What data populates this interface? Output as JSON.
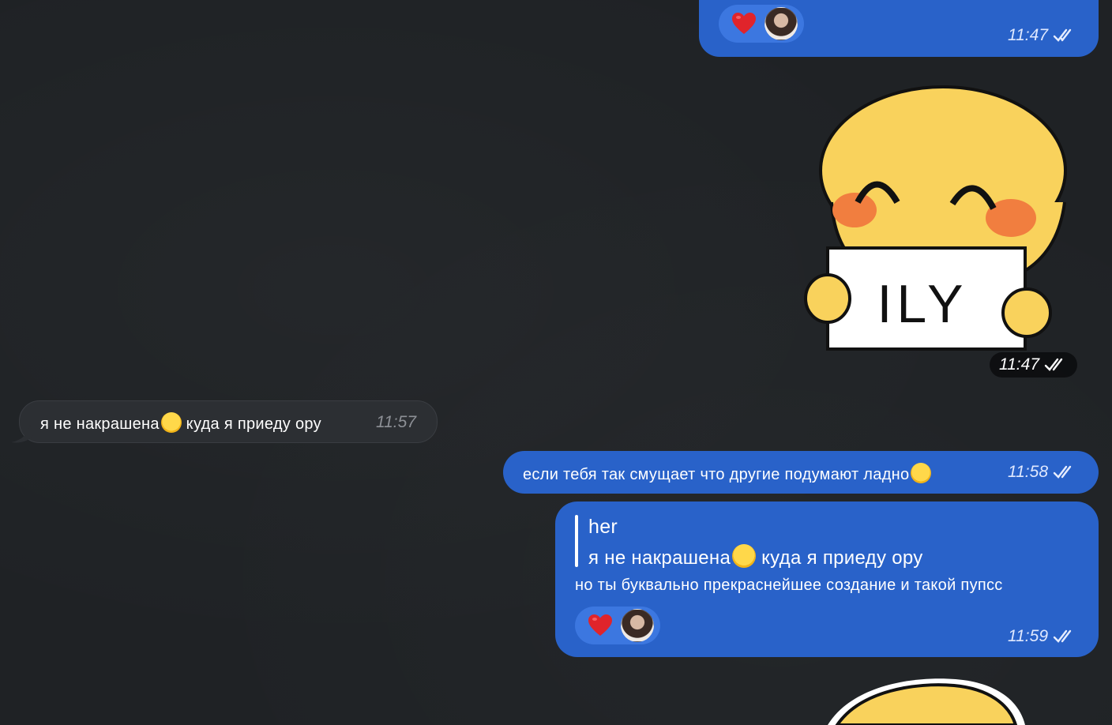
{
  "messages": {
    "m1": {
      "time": "11:47"
    },
    "sticker1": {
      "caption": "ILY",
      "time": "11:47"
    },
    "m2": {
      "text_before_emoji": "я не накрашена",
      "text_after_emoji": " куда я приеду ору",
      "emoji": "loudly-crying-face",
      "time": "11:57"
    },
    "m3": {
      "text": "если тебя так смущает что другие подумают ладно",
      "emoji": "crying-face",
      "time": "11:58"
    },
    "m4": {
      "reply_author": "her",
      "reply_text_before_emoji": "я не накрашена",
      "reply_text_after_emoji": " куда я приеду ору",
      "text": "но ты буквально прекраснейшее создание и такой пупсс",
      "time": "11:59"
    }
  },
  "reactions": {
    "emoji": "red-heart",
    "color": "#e0242b"
  },
  "colors": {
    "outgoing_bubble": "#2962c9",
    "incoming_bubble": "#2c2f33",
    "background": "#1f2225"
  }
}
